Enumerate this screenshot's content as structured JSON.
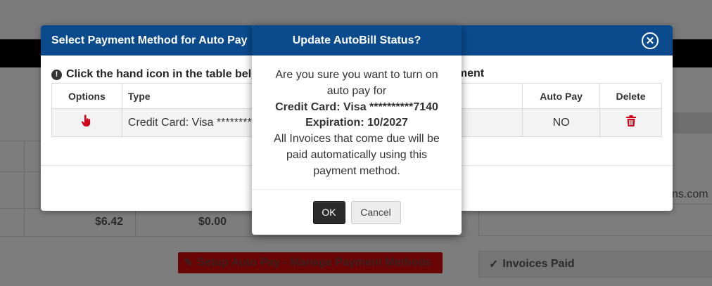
{
  "background": {
    "amounts": [
      "$6.42",
      "$0.00"
    ],
    "right_text": "ns.com",
    "setup_button_label": "Setup Auto Pay - Manage Payment Methods",
    "invoices_paid_label": "Invoices Paid"
  },
  "payment_modal": {
    "title": "Select Payment Method for Auto Pay",
    "close_icon": "close-circle-icon",
    "instruction": "Click the hand icon in the table below to select a payment method for Auto Payment",
    "instruction_visible_left": "Click the hand icon in the table bel",
    "instruction_visible_right": "yment",
    "columns": {
      "options": "Options",
      "type": "Type",
      "auto_pay": "Auto Pay",
      "delete": "Delete"
    },
    "rows": [
      {
        "type": "Credit Card: Visa ********",
        "auto_pay": "NO",
        "select_icon": "hand-pointer-icon",
        "delete_icon": "trash-icon"
      }
    ]
  },
  "confirm_modal": {
    "title": "Update AutoBill Status?",
    "line1": "Are you sure you want to turn on auto pay for",
    "card": "Credit Card: Visa **********7140",
    "expiration": "Expiration: 10/2027",
    "line2": "All Invoices that come due will be paid automatically using this payment method.",
    "ok_label": "OK",
    "cancel_label": "Cancel"
  },
  "colors": {
    "header_blue": "#0b4a8c",
    "danger_red": "#d0021b",
    "overlay_gray": "#7d7d7d"
  }
}
